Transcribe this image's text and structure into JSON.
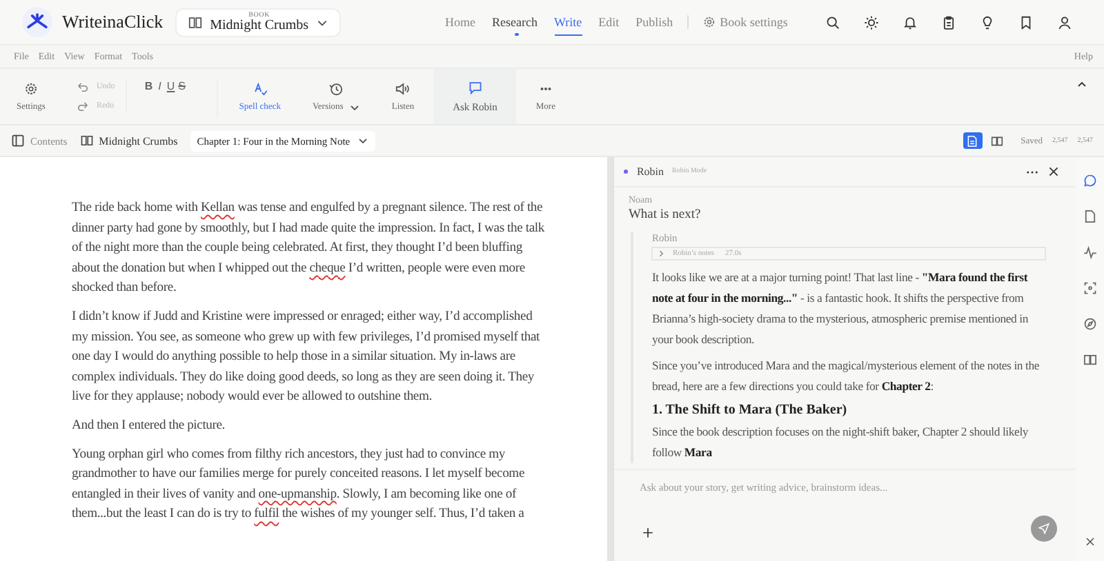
{
  "app": {
    "name": "WriteinaClick"
  },
  "book_selector": {
    "label": "BOOK",
    "title": "Midnight Crumbs"
  },
  "nav": [
    {
      "label": "Home",
      "selected": false,
      "dot": false
    },
    {
      "label": "Research",
      "selected": false,
      "dot": true
    },
    {
      "label": "Write",
      "selected": true,
      "dot": false
    },
    {
      "label": "Edit",
      "selected": false,
      "dot": false
    },
    {
      "label": "Publish",
      "selected": false,
      "dot": false
    }
  ],
  "book_settings": "Book settings",
  "header_icons": [
    {
      "kind": "search"
    },
    {
      "kind": "sun"
    },
    {
      "kind": "bell"
    },
    {
      "kind": "clipboard"
    },
    {
      "kind": "bulb"
    },
    {
      "kind": "bookmark"
    },
    {
      "kind": "user"
    }
  ],
  "menu": [
    "File",
    "Edit",
    "View",
    "Format",
    "Tools"
  ],
  "help": "Help",
  "toolbar": [
    {
      "kind": "settings",
      "label": "Settings"
    },
    {
      "kind": "history",
      "items": [
        {
          "label": "Undo",
          "disabled": true
        },
        {
          "label": "Redo",
          "disabled": true
        }
      ]
    },
    {
      "kind": "format",
      "items": [
        "B",
        "I",
        "U",
        "S"
      ]
    },
    {
      "kind": "spell",
      "label": "Spell check",
      "active": true
    },
    {
      "kind": "versions",
      "label": "Versions",
      "active": false
    },
    {
      "kind": "listen",
      "label": "Listen",
      "active": false
    },
    {
      "kind": "ask",
      "label": "Ask Robin",
      "active": true
    },
    {
      "kind": "more",
      "label": "More",
      "active": false
    }
  ],
  "breadcrumb": {
    "contents": "Contents",
    "book": "Midnight Crumbs",
    "chapter": "Chapter 1: Four in the Morning Note"
  },
  "view_toggle": [
    {
      "kind": "page",
      "selected": true
    },
    {
      "kind": "book",
      "selected": false
    }
  ],
  "status": {
    "saved": "Saved",
    "counts": [
      "2,547",
      "2,547"
    ]
  },
  "editor": {
    "paragraphs": [
      [
        {
          "text": "The ride back home with ",
          "misspelled": false
        },
        {
          "text": "Kellan",
          "misspelled": true
        },
        {
          "text": " was tense and engulfed by a pregnant silence. The rest of the dinner party had gone by smoothly, but I had made quite the impression. In fact, I was the talk of the night more than the couple being celebrated. At first, they thought I’d been bluffing about the donation but when I whipped out the ",
          "misspelled": false
        },
        {
          "text": "cheque",
          "misspelled": true
        },
        {
          "text": " I’d written, people were even more shocked than before.",
          "misspelled": false
        }
      ],
      [
        {
          "text": "I didn’t know if Judd and Kristine were impressed or enraged; either way, I’d accomplished my mission. You see, as someone who grew up with few privileges, I’d promised myself that one day I would do anything possible to help those in a similar situation. My in-laws are complex individuals. They do like doing good deeds, so long as they are seen doing it. They live for they applause; nobody would ever be allowed to outshine them.",
          "misspelled": false
        }
      ],
      [
        {
          "text": "And then I entered the picture.",
          "misspelled": false
        }
      ],
      [
        {
          "text": "Young orphan girl who comes from filthy rich ancestors, they just had to convince my grandmother to have our families merge for purely conceited reasons. I let myself become entangled in their lives of vanity and ",
          "misspelled": false
        },
        {
          "text": "one-upmanship",
          "misspelled": true
        },
        {
          "text": ". Slowly, I am becoming like one of them...but the least I can do is try to ",
          "misspelled": false
        },
        {
          "text": "fulfil",
          "misspelled": true
        },
        {
          "text": " the wishes of my younger self. Thus, I’d taken a",
          "misspelled": false
        }
      ]
    ]
  },
  "chat": {
    "title": "Robin",
    "mode": "Robin Mode",
    "user": "Noam",
    "question": "What is next?",
    "reply_author": "Robin",
    "notes": {
      "label": "Robin’s notes",
      "time": "27.0s",
      "expanded": false
    },
    "blocks": [
      {
        "kind": "p",
        "text": "It looks like we are at a major turning point! That last line - **\"Mara found the first note at four in the morning...\"** - is a fantastic hook. It shifts the perspective from Brianna’s high-society drama to the mysterious, atmospheric premise mentioned in your book description."
      },
      {
        "kind": "p",
        "text": "Since you’ve introduced Mara and the magical/mysterious element of the notes in the bread, here are a few directions you could take for **Chapter 2**:"
      },
      {
        "kind": "h",
        "text": "1. The Shift to Mara (The Baker)"
      },
      {
        "kind": "p",
        "text": "Since the book description focuses on the night-shift baker, Chapter 2 should likely follow **Mara**"
      }
    ],
    "input": {
      "placeholder": "Ask about your story, get writing advice, brainstorm ideas..."
    }
  },
  "rail": [
    {
      "kind": "chat",
      "selected": true
    },
    {
      "kind": "document",
      "selected": false
    },
    {
      "kind": "activity",
      "selected": false
    },
    {
      "kind": "scan",
      "selected": false
    },
    {
      "kind": "compass",
      "selected": false
    },
    {
      "kind": "book",
      "selected": false
    }
  ]
}
